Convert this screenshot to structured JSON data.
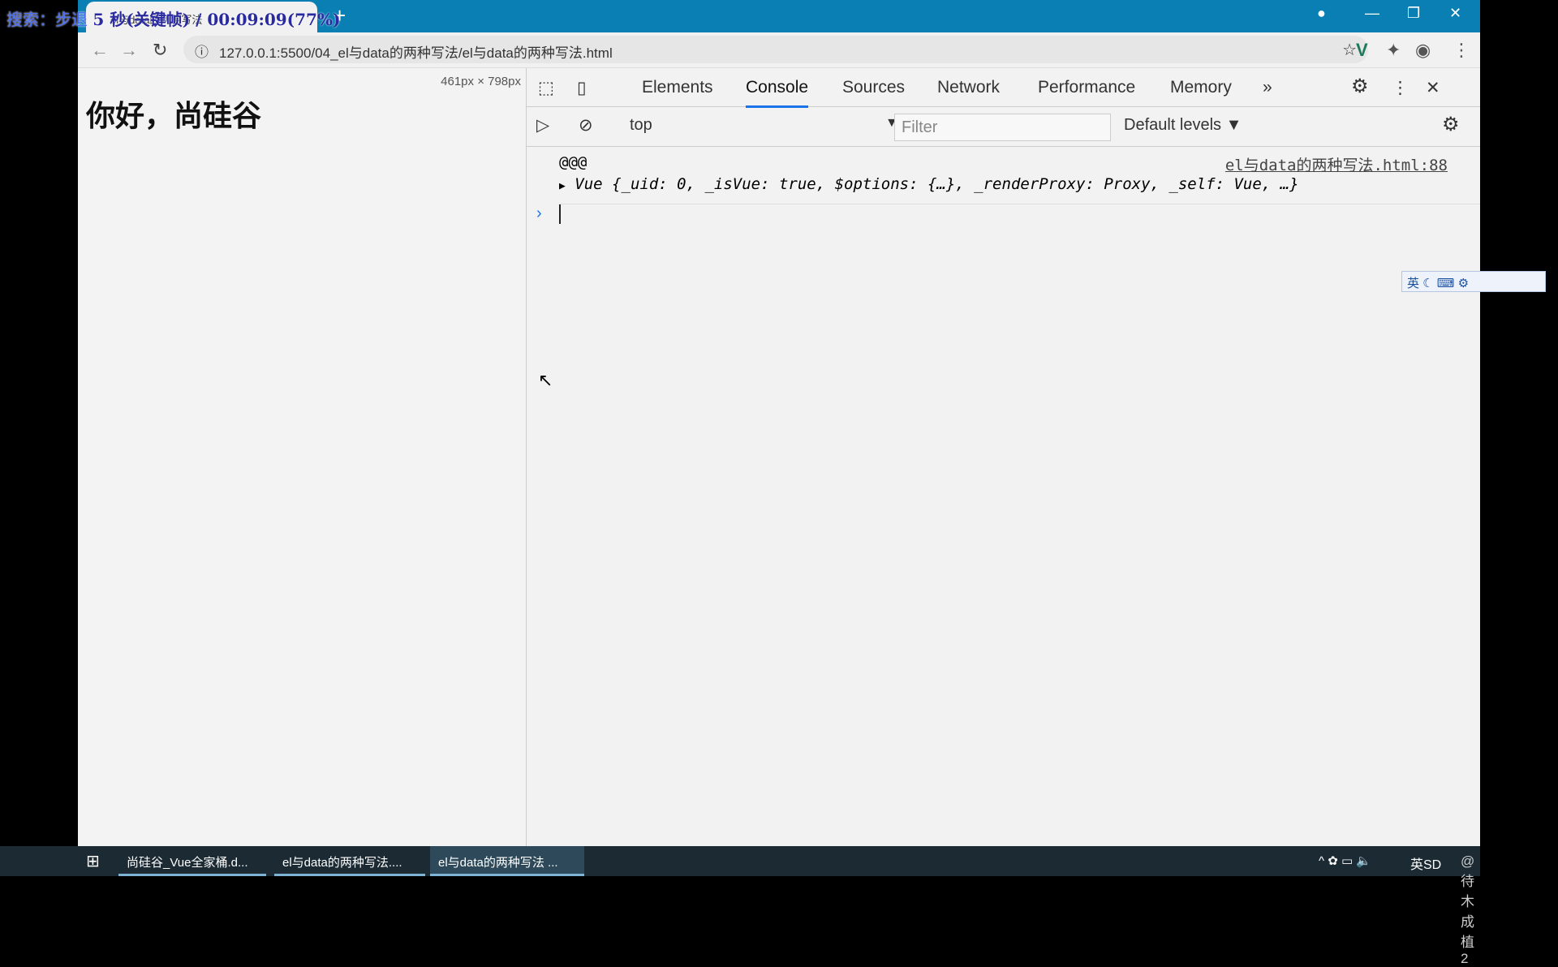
{
  "overlay": {
    "text": "搜索：步退",
    "bold": "5 秒(关键帧) / 00:09:09(77%)"
  },
  "browser": {
    "tab_title": "el与data的两种写法",
    "url": "127.0.0.1:5500/04_el与data的两种写法/el与data的两种写法.html"
  },
  "page": {
    "heading": "你好，尚硅谷",
    "viewport_size": "461px × 798px"
  },
  "devtools": {
    "tabs": [
      "Elements",
      "Console",
      "Sources",
      "Network",
      "Performance",
      "Memory"
    ],
    "active_tab": "Console",
    "context": "top",
    "filter_placeholder": "Filter",
    "levels": "Default levels ▼",
    "console": {
      "log1": "@@@",
      "source": "el与data的两种写法.html:88",
      "obj_prefix": "Vue",
      "obj_body": "{_uid: 0, _isVue: true, $options: {…}, _renderProxy: Proxy, _self: Vue, …}"
    }
  },
  "ime": "英",
  "taskbar": {
    "items": [
      "尚硅谷_Vue全家桶.d...",
      "el与data的两种写法....",
      "el与data的两种写法 ..."
    ],
    "tray": "英SD",
    "watermark": "@待木成植2"
  }
}
